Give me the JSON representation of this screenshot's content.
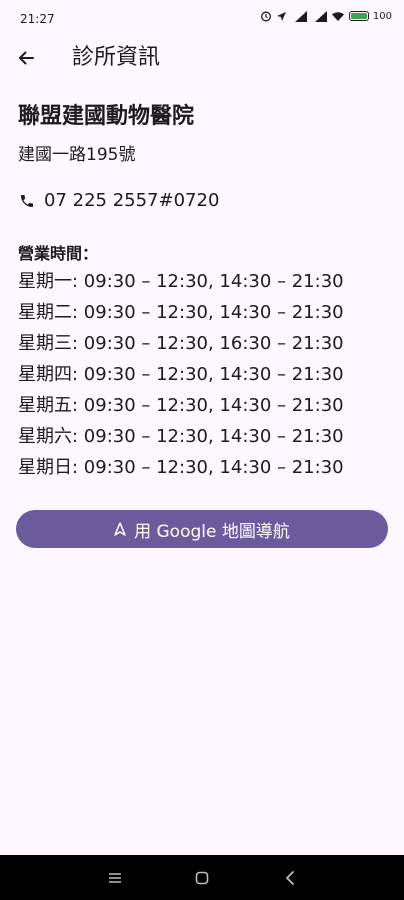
{
  "status_bar": {
    "time": "21:27",
    "battery_percent": "100"
  },
  "app_bar": {
    "title": "診所資訊"
  },
  "clinic": {
    "name": "聯盟建國動物醫院",
    "address": "建國一路195號",
    "phone": "07 225 2557#0720"
  },
  "hours": {
    "title": "營業時間：",
    "rows": [
      "星期一: 09:30 – 12:30, 14:30 – 21:30",
      "星期二: 09:30 – 12:30, 14:30 – 21:30",
      "星期三: 09:30 – 12:30, 16:30 – 21:30",
      "星期四: 09:30 – 12:30, 14:30 – 21:30",
      "星期五: 09:30 – 12:30, 14:30 – 21:30",
      "星期六: 09:30 – 12:30, 14:30 – 21:30",
      "星期日: 09:30 – 12:30, 14:30 – 21:30"
    ]
  },
  "actions": {
    "navigate_label": "用 Google 地圖導航"
  },
  "colors": {
    "background": "#fdf7ff",
    "primary": "#6b5a9c",
    "text": "#1d1b20"
  },
  "icons": {
    "back": "arrow-back-icon",
    "phone": "phone-icon",
    "navigate": "navigation-icon",
    "nav_menu": "menu-icon",
    "nav_home": "home-icon",
    "nav_back": "back-chevron-icon"
  }
}
